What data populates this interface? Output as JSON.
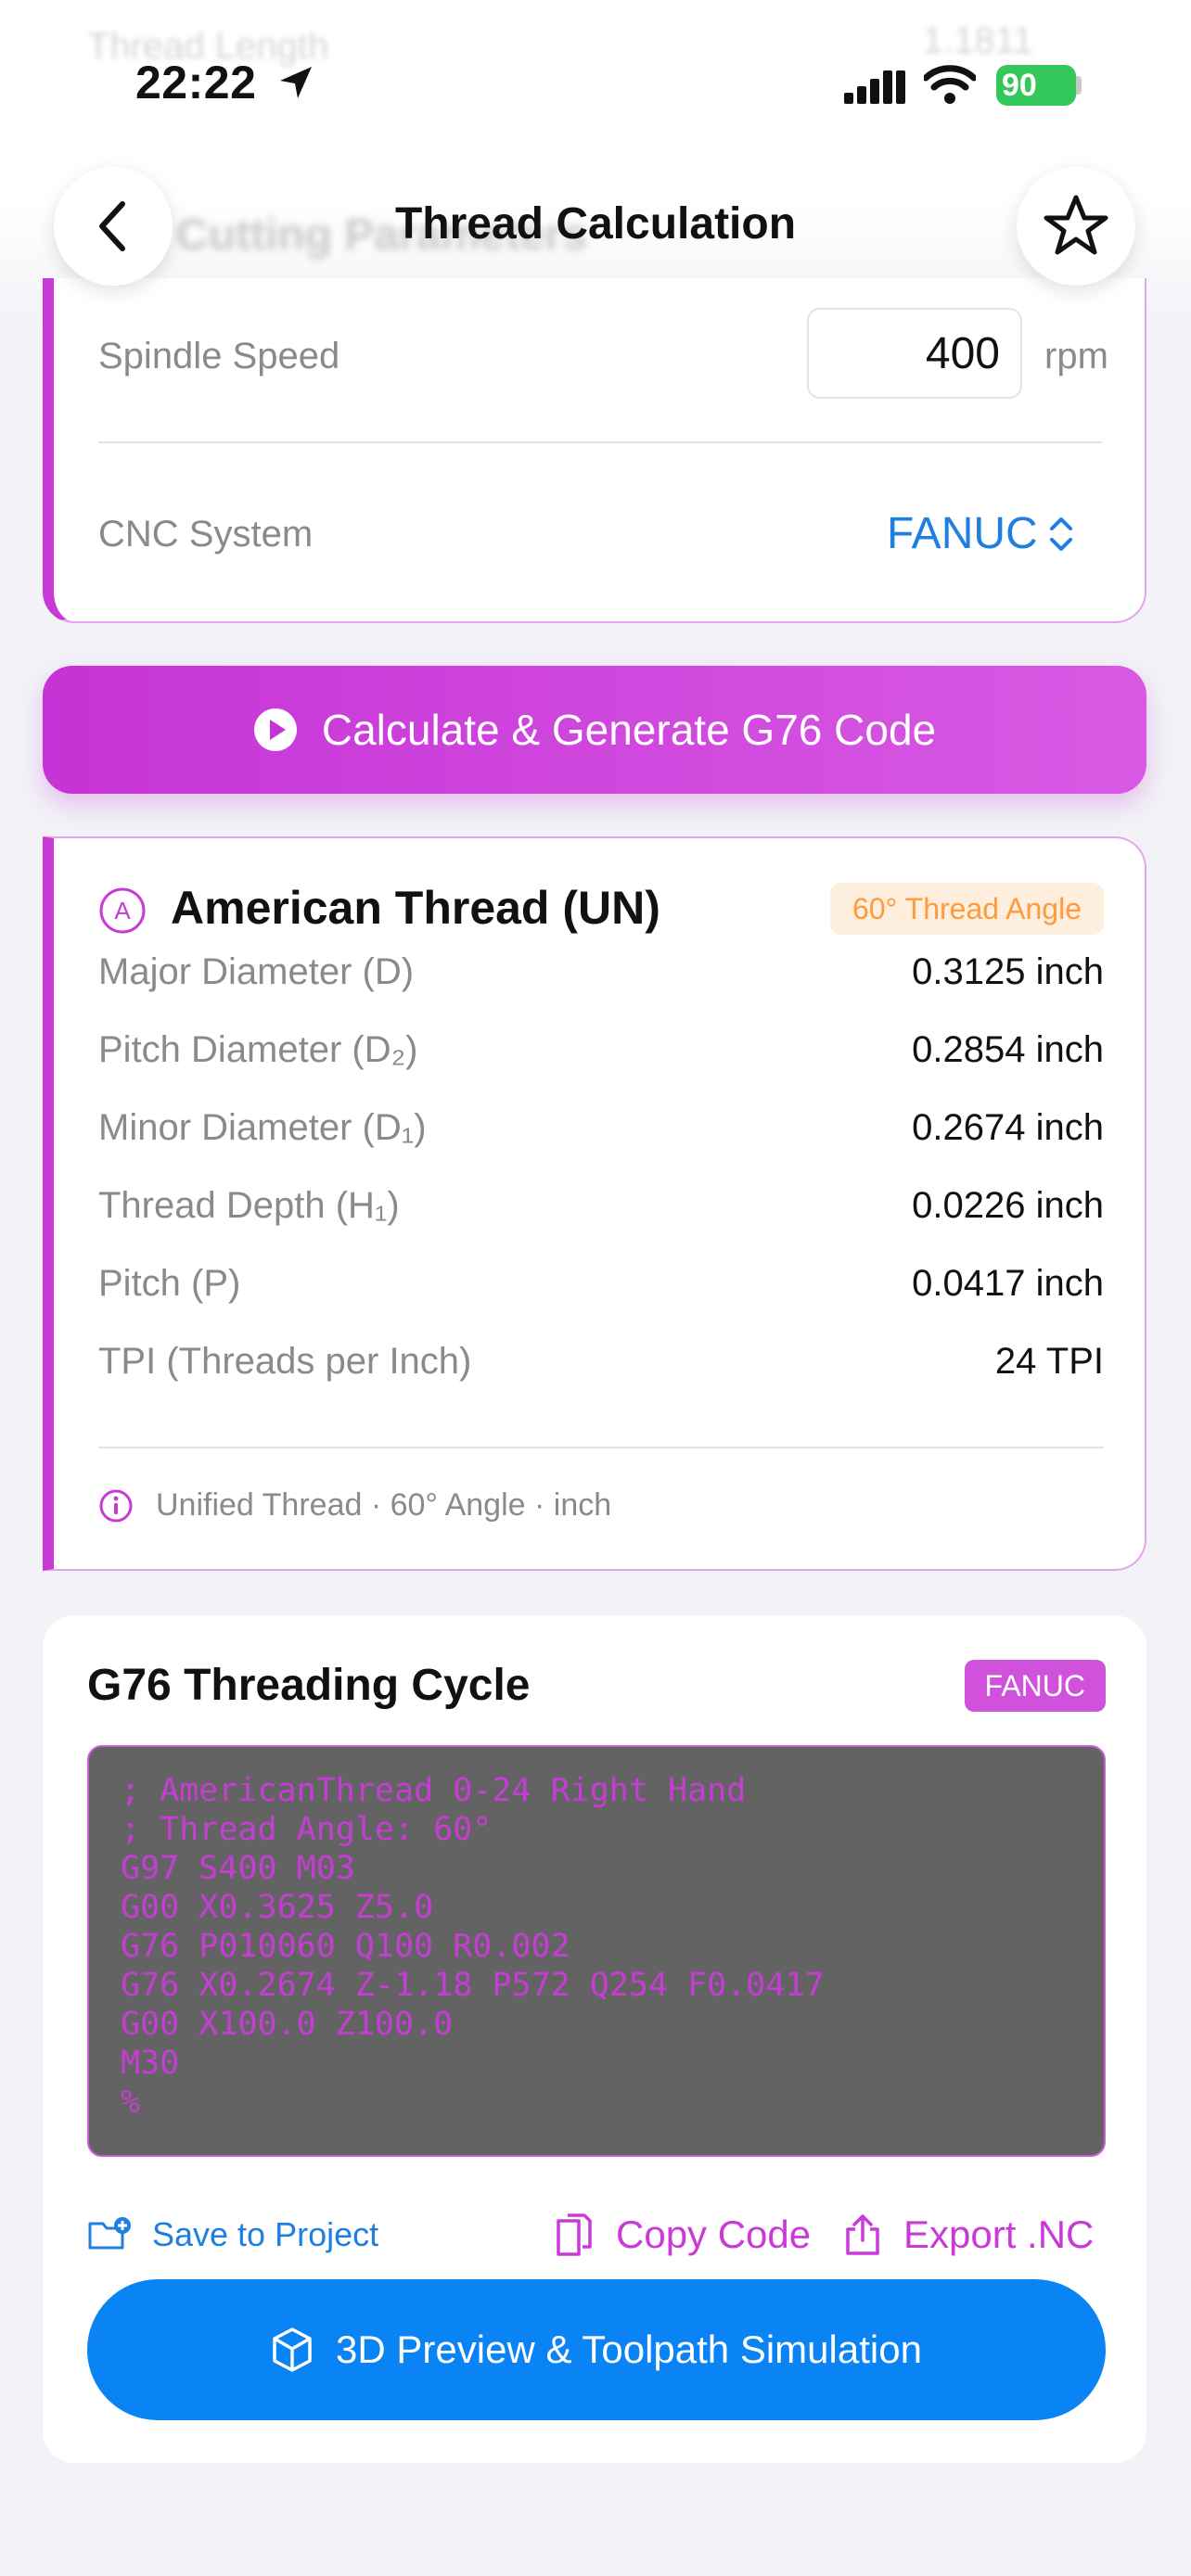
{
  "status_bar": {
    "time": "22:22",
    "battery": "90"
  },
  "background_ghost": {
    "row_label": "Thread Length",
    "row_value": "1.1811",
    "section_title": "Cutting Parameters"
  },
  "nav": {
    "title": "Thread Calculation",
    "back_icon": "chevron-left-icon",
    "favorite_icon": "star-icon"
  },
  "params": {
    "spindle_label": "Spindle Speed",
    "spindle_value": "400",
    "spindle_unit": "rpm",
    "cnc_label": "CNC System",
    "cnc_value": "FANUC"
  },
  "calculate_button": {
    "label": "Calculate & Generate G76 Code",
    "icon": "play-circle-icon"
  },
  "thread_result": {
    "title": "American Thread (UN)",
    "badge": "60° Thread Angle",
    "rows": [
      {
        "label": "Major Diameter (D)",
        "value": "0.3125 inch"
      },
      {
        "label": "Pitch Diameter (D₂)",
        "value": "0.2854 inch"
      },
      {
        "label": "Minor Diameter (D₁)",
        "value": "0.2674 inch"
      },
      {
        "label": "Thread Depth (H₁)",
        "value": "0.0226 inch"
      },
      {
        "label": "Pitch (P)",
        "value": "0.0417 inch"
      },
      {
        "label": "TPI (Threads per Inch)",
        "value": "24 TPI"
      }
    ],
    "info": "Unified Thread · 60° Angle · inch"
  },
  "g76": {
    "title": "G76 Threading Cycle",
    "badge": "FANUC",
    "code": "; AmericanThread 0-24 Right Hand\n; Thread Angle: 60°\nG97 S400 M03\nG00 X0.3625 Z5.0\nG76 P010060 Q100 R0.002\nG76 X0.2674 Z-1.18 P572 Q254 F0.0417\nG00 X100.0 Z100.0\nM30\n%",
    "save_label": "Save to Project",
    "copy_label": "Copy Code",
    "export_label": "Export .NC",
    "preview_label": "3D Preview & Toolpath Simulation"
  },
  "colors": {
    "accent_purple": "#c83ad6",
    "link_blue": "#1e7fe0",
    "primary_blue": "#0a84f5",
    "badge_orange": "#ff9a3d"
  }
}
